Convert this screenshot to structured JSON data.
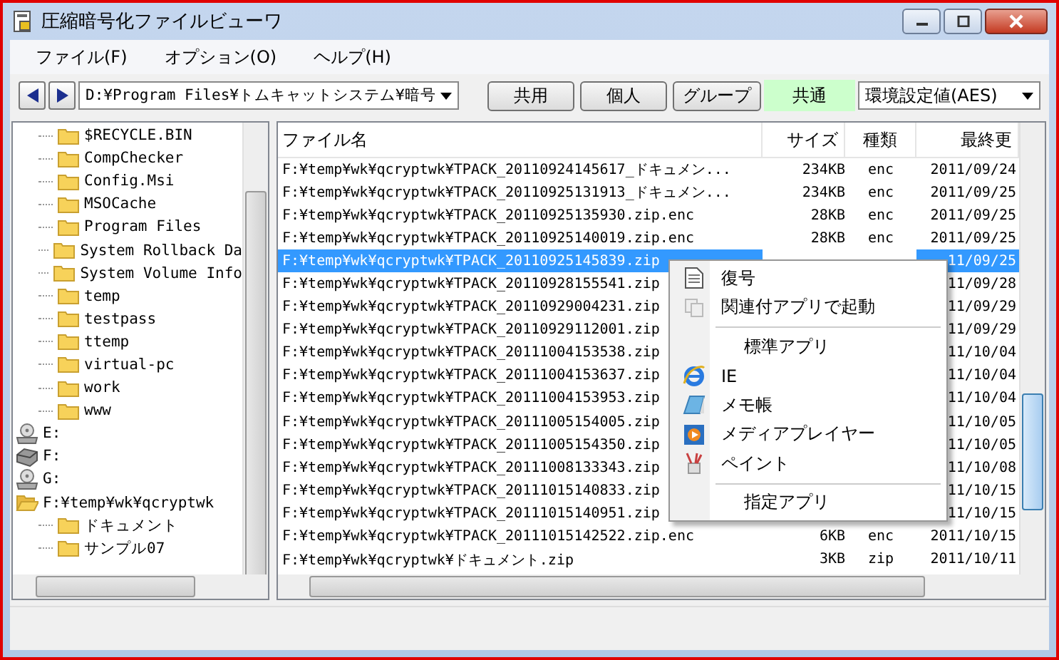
{
  "window": {
    "title": "圧縮暗号化ファイルビューワ"
  },
  "menu": [
    "ファイル(F)",
    "オプション(O)",
    "ヘルプ(H)"
  ],
  "toolbar": {
    "path": "D:¥Program Files¥トムキャットシステム¥暗号",
    "buttons": [
      "共用",
      "個人",
      "グループ"
    ],
    "mode_label": "共通",
    "setting": "環境設定値(AES)"
  },
  "tree": [
    {
      "children": [
        {
          "label": "$RECYCLE.BIN",
          "kind": "folder"
        },
        {
          "label": "CompChecker",
          "kind": "folder"
        },
        {
          "label": "Config.Msi",
          "kind": "folder"
        },
        {
          "label": "MSOCache",
          "kind": "folder"
        },
        {
          "label": "Program Files",
          "kind": "folder"
        },
        {
          "label": "System Rollback Da",
          "kind": "folder"
        },
        {
          "label": "System Volume Info",
          "kind": "folder"
        },
        {
          "label": "temp",
          "kind": "folder"
        },
        {
          "label": "testpass",
          "kind": "folder"
        },
        {
          "label": "ttemp",
          "kind": "folder"
        },
        {
          "label": "virtual-pc",
          "kind": "folder"
        },
        {
          "label": "work",
          "kind": "folder"
        },
        {
          "label": "www",
          "kind": "folder"
        }
      ]
    },
    {
      "label": "E:",
      "kind": "disc"
    },
    {
      "label": "F:",
      "kind": "drive"
    },
    {
      "label": "G:",
      "kind": "disc"
    },
    {
      "label": "F:¥temp¥wk¥qcryptwk",
      "kind": "open-folder",
      "children": [
        {
          "label": "ドキュメント",
          "kind": "folder"
        },
        {
          "label": "サンプル07",
          "kind": "folder"
        }
      ]
    }
  ],
  "table": {
    "columns": [
      "ファイル名",
      "サイズ",
      "種類",
      "最終更"
    ],
    "rows": [
      {
        "name": "F:¥temp¥wk¥qcryptwk¥TPACK_20110924145617_ドキュメン...",
        "size": "234KB",
        "type": "enc",
        "date": "2011/09/24",
        "selected": false
      },
      {
        "name": "F:¥temp¥wk¥qcryptwk¥TPACK_20110925131913_ドキュメン...",
        "size": "234KB",
        "type": "enc",
        "date": "2011/09/25",
        "selected": false
      },
      {
        "name": "F:¥temp¥wk¥qcryptwk¥TPACK_20110925135930.zip.enc",
        "size": "28KB",
        "type": "enc",
        "date": "2011/09/25",
        "selected": false
      },
      {
        "name": "F:¥temp¥wk¥qcryptwk¥TPACK_20110925140019.zip.enc",
        "size": "28KB",
        "type": "enc",
        "date": "2011/09/25",
        "selected": false
      },
      {
        "name": "F:¥temp¥wk¥qcryptwk¥TPACK_20110925145839.zip",
        "date": "11/09/25",
        "selected": true
      },
      {
        "name": "F:¥temp¥wk¥qcryptwk¥TPACK_20110928155541.zip",
        "date": "11/09/28",
        "selected": false
      },
      {
        "name": "F:¥temp¥wk¥qcryptwk¥TPACK_20110929004231.zip",
        "date": "11/09/29",
        "selected": false
      },
      {
        "name": "F:¥temp¥wk¥qcryptwk¥TPACK_20110929112001.zip",
        "date": "11/09/29",
        "selected": false
      },
      {
        "name": "F:¥temp¥wk¥qcryptwk¥TPACK_20111004153538.zip",
        "date": "11/10/04",
        "selected": false
      },
      {
        "name": "F:¥temp¥wk¥qcryptwk¥TPACK_20111004153637.zip",
        "date": "11/10/04",
        "selected": false
      },
      {
        "name": "F:¥temp¥wk¥qcryptwk¥TPACK_20111004153953.zip",
        "date": "11/10/04",
        "selected": false
      },
      {
        "name": "F:¥temp¥wk¥qcryptwk¥TPACK_20111005154005.zip",
        "date": "11/10/05",
        "selected": false
      },
      {
        "name": "F:¥temp¥wk¥qcryptwk¥TPACK_20111005154350.zip",
        "date": "11/10/05",
        "selected": false
      },
      {
        "name": "F:¥temp¥wk¥qcryptwk¥TPACK_20111008133343.zip",
        "date": "11/10/08",
        "selected": false
      },
      {
        "name": "F:¥temp¥wk¥qcryptwk¥TPACK_20111015140833.zip",
        "date": "11/10/15",
        "selected": false
      },
      {
        "name": "F:¥temp¥wk¥qcryptwk¥TPACK_20111015140951.zip",
        "date": "11/10/15",
        "selected": false
      },
      {
        "name": "F:¥temp¥wk¥qcryptwk¥TPACK_20111015142522.zip.enc",
        "size": "6KB",
        "type": "enc",
        "date": "2011/10/15",
        "selected": false
      },
      {
        "name": "F:¥temp¥wk¥qcryptwk¥ドキュメント.zip",
        "size": "3KB",
        "type": "zip",
        "date": "2011/10/11",
        "selected": false
      }
    ]
  },
  "context_menu": [
    {
      "kind": "document",
      "label": "復号"
    },
    {
      "kind": "copies",
      "label": "関連付アプリで起動"
    },
    {
      "kind": "separator"
    },
    {
      "kind": "heading",
      "label": "標準アプリ"
    },
    {
      "kind": "browser",
      "label": "IE"
    },
    {
      "kind": "notepad",
      "label": "メモ帳"
    },
    {
      "kind": "player",
      "label": "メディアプレイヤー"
    },
    {
      "kind": "paint",
      "label": "ペイント"
    },
    {
      "kind": "separator"
    },
    {
      "kind": "heading",
      "label": "指定アプリ"
    }
  ]
}
